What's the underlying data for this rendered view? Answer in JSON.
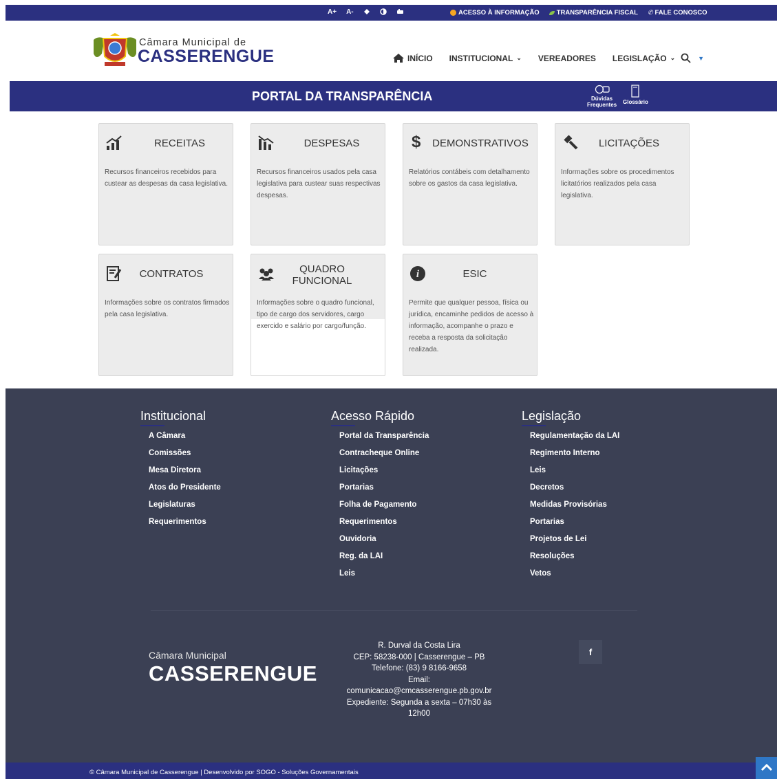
{
  "topbar": {
    "font_increase": "A+",
    "font_decrease": "A-",
    "access_info": "ACESSO À INFORMAÇÃO",
    "fiscal": "TRANSPARÊNCIA FISCAL",
    "contact": "FALE CONOSCO"
  },
  "header": {
    "logo_small": "Câmara Municipal de",
    "logo_big": "CASSERENGUE"
  },
  "nav": {
    "home": "INÍCIO",
    "institucional": "INSTITUCIONAL",
    "vereadores": "VEREADORES",
    "legislacao": "LEGISLAÇÃO"
  },
  "banner": {
    "title": "PORTAL DA TRANSPARÊNCIA",
    "faq_line1": "Dúvidas",
    "faq_line2": "Frequentes",
    "glossary": "Glossário"
  },
  "cards": [
    {
      "label": "RECEITAS",
      "icon": "chart-up-icon",
      "desc": "Recursos financeiros recebidos para custear as despesas da casa legislativa."
    },
    {
      "label": "DESPESAS",
      "icon": "chart-down-icon",
      "desc": "Recursos financeiros usados pela casa legislativa para custear suas respectivas despesas."
    },
    {
      "label": "DEMONSTRATIVOS",
      "icon": "dollar-icon",
      "desc": "Relatórios contábeis com detalhamento sobre os gastos da casa legislativa."
    },
    {
      "label": "LICITAÇÕES",
      "icon": "gavel-icon",
      "desc": "Informações sobre os procedimentos licitatórios realizados pela casa legislativa."
    },
    {
      "label": "CONTRATOS",
      "icon": "contract-icon",
      "desc": "Informações sobre os contratos firmados pela casa legislativa."
    },
    {
      "label_line1": "QUADRO",
      "label_line2": "FUNCIONAL",
      "icon": "users-icon",
      "desc": "Informações sobre o quadro funcional, tipo de cargo dos servidores, cargo exercido e salário por cargo/função."
    },
    {
      "label": "ESIC",
      "icon": "info-icon",
      "desc": "Permite que qualquer pessoa, física ou jurídica, encaminhe pedidos de acesso à informação, acompanhe o prazo e receba a resposta da solicitação realizada."
    }
  ],
  "footer": {
    "institucional": {
      "title": "Institucional",
      "items": [
        "A Câmara",
        "Comissões",
        "Mesa Diretora",
        "Atos do Presidente",
        "Legislaturas",
        "Requerimentos"
      ]
    },
    "acesso": {
      "title": "Acesso Rápido",
      "items": [
        "Portal da Transparência",
        "Contracheque Online",
        "Licitações",
        "Portarias",
        "Folha de Pagamento",
        "Requerimentos",
        "Ouvidoria",
        "Reg. da LAI",
        "Leis"
      ]
    },
    "legislacao": {
      "title": "Legislação",
      "items": [
        "Regulamentação da LAI",
        "Regimento Interno",
        "Leis",
        "Decretos",
        "Medidas Provisórias",
        "Portarias",
        "Projetos de Lei",
        "Resoluções",
        "Vetos"
      ]
    },
    "logo_small": "Câmara Municipal",
    "logo_big": "CASSERENGUE",
    "address": {
      "line1": "R. Durval da Costa Lira",
      "line2": "CEP: 58238-000 | Casserengue – PB",
      "line3": "Telefone: (83) 9 8166-9658",
      "line4": "Email:",
      "line5": "comunicacao@cmcasserengue.pb.gov.br",
      "line6": "Expediente: Segunda a sexta – 07h30 às",
      "line7": "12h00"
    },
    "facebook": "f"
  },
  "bottombar": {
    "text": "© Câmara Municipal de Casserengue | Desenvolvido por SOGO - Soluções Governamentais"
  },
  "colors": {
    "brand_blue": "#2b3080",
    "footer_bg": "#3b4054",
    "card_bg": "#ececec",
    "to_top": "#2f77c6"
  }
}
